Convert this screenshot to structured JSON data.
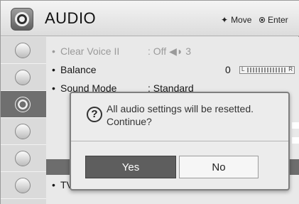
{
  "header": {
    "title": "AUDIO",
    "move_label": "Move",
    "enter_label": "Enter",
    "icon": "speaker-icon"
  },
  "sidebar": {
    "items": [
      {
        "name": "picture-icon"
      },
      {
        "name": "screen-icon"
      },
      {
        "name": "audio-icon",
        "active": true
      },
      {
        "name": "time-icon"
      },
      {
        "name": "lock-icon"
      },
      {
        "name": "option-icon"
      }
    ]
  },
  "settings": [
    {
      "bullet": "•",
      "label": "Clear Voice II",
      "value": ": Off ◀◗ 3",
      "dim": true
    },
    {
      "bullet": "•",
      "label": "Balance",
      "number": "0",
      "left": "L",
      "right": "R",
      "level": 0.5
    },
    {
      "bullet": "•",
      "label": "Sound Mode",
      "value": ": Standard"
    },
    {
      "bullet": "•",
      "label": "TV"
    }
  ],
  "dialog": {
    "icon": "?",
    "message_line1": "All audio settings will be resetted.",
    "message_line2": "Continue?",
    "yes_label": "Yes",
    "no_label": "No"
  },
  "colors": {
    "accent_dark": "#5e5e5e",
    "background": "#e6e6e6"
  }
}
